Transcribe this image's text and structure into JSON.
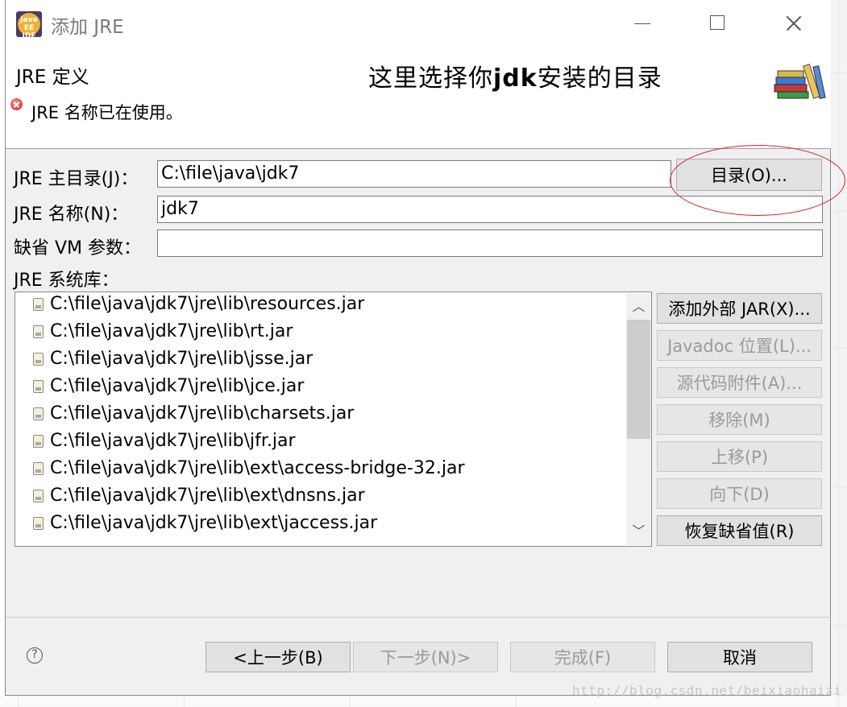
{
  "window": {
    "title": "添加 JRE",
    "app_icon_text": "Java EE IDE"
  },
  "header": {
    "title": "JRE 定义",
    "note_prefix": "这里选择你",
    "note_bold": "jdk",
    "note_suffix": "安装的目录",
    "error_message": "JRE 名称已在使用。"
  },
  "form": {
    "jre_home_label": "JRE 主目录(J)：",
    "jre_home_value": "C:\\file\\java\\jdk7",
    "directory_button": "目录(O)...",
    "jre_name_label": "JRE 名称(N)：",
    "jre_name_value": "jdk7",
    "vm_args_label": "缺省 VM 参数：",
    "vm_args_value": "",
    "libraries_label": "JRE 系统库："
  },
  "libraries": [
    "C:\\file\\java\\jdk7\\jre\\lib\\resources.jar",
    "C:\\file\\java\\jdk7\\jre\\lib\\rt.jar",
    "C:\\file\\java\\jdk7\\jre\\lib\\jsse.jar",
    "C:\\file\\java\\jdk7\\jre\\lib\\jce.jar",
    "C:\\file\\java\\jdk7\\jre\\lib\\charsets.jar",
    "C:\\file\\java\\jdk7\\jre\\lib\\jfr.jar",
    "C:\\file\\java\\jdk7\\jre\\lib\\ext\\access-bridge-32.jar",
    "C:\\file\\java\\jdk7\\jre\\lib\\ext\\dnsns.jar",
    "C:\\file\\java\\jdk7\\jre\\lib\\ext\\jaccess.jar"
  ],
  "side_buttons": {
    "add_external_jar": "添加外部 JAR(X)...",
    "javadoc_location": "Javadoc 位置(L)...",
    "source_attachment": "源代码附件(A)...",
    "remove": "移除(M)",
    "move_up": "上移(P)",
    "move_down": "向下(D)",
    "restore_default": "恢复缺省值(R)"
  },
  "footer": {
    "back": "<上一步(B)",
    "next": "下一步(N)>",
    "finish": "完成(F)",
    "cancel": "取消"
  },
  "watermark": "http://blog.csdn.net/beixiaohaizi",
  "colors": {
    "annotation_red": "#e02020",
    "dialog_bg": "#f0f0f0",
    "disabled_text": "#9a9a9a"
  },
  "icons": {
    "library_entry": "jar-file-icon",
    "error": "error-icon",
    "help": "help-icon",
    "banner": "books-icon"
  }
}
